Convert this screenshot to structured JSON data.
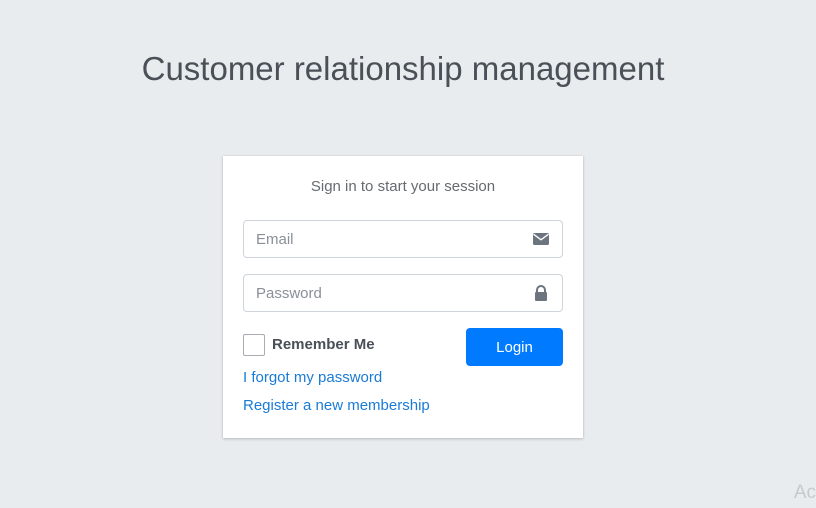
{
  "page_title": "Customer relationship management",
  "login_box": {
    "subtitle": "Sign in to start your session",
    "email": {
      "placeholder": "Email",
      "icon": "envelope-icon"
    },
    "password": {
      "placeholder": "Password",
      "icon": "lock-icon"
    },
    "remember_label": "Remember Me",
    "remember_checked": false,
    "login_label": "Login",
    "forgot_link": "I forgot my password",
    "register_link": "Register a new membership"
  },
  "watermark": "Ac",
  "colors": {
    "background": "#e9ecef",
    "primary": "#007bff",
    "link": "#1a7bd6"
  }
}
